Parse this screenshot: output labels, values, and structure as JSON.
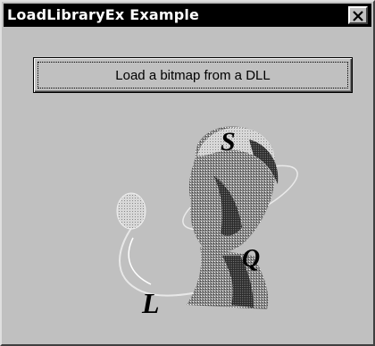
{
  "window": {
    "title": "LoadLibraryEx Example"
  },
  "titlebar": {
    "close_icon": "close-icon"
  },
  "main": {
    "load_button_label": "Load a bitmap from a DLL",
    "bitmap": {
      "letters": [
        "S",
        "Q",
        "L"
      ]
    }
  }
}
